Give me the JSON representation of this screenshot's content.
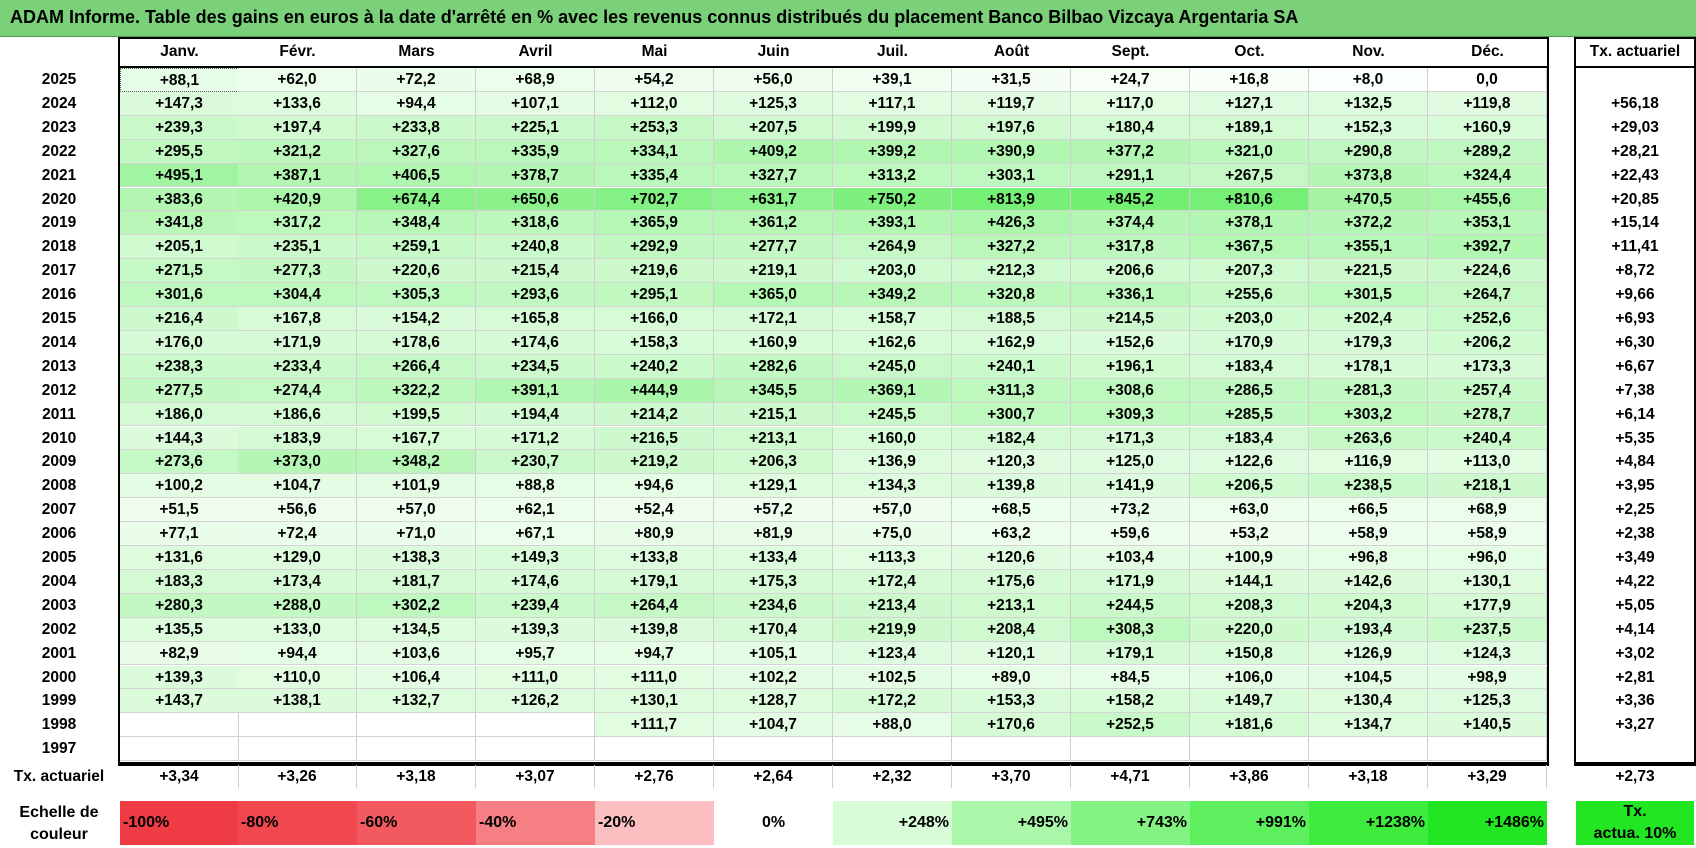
{
  "title": "ADAM Informe. Table des gains en euros à la date d'arrêté en % avec les revenus connus distribués du placement Banco Bilbao Vizcaya Argentaria SA",
  "months": [
    "Janv.",
    "Févr.",
    "Mars",
    "Avril",
    "Mai",
    "Juin",
    "Juil.",
    "Août",
    "Sept.",
    "Oct.",
    "Nov.",
    "Déc."
  ],
  "rate_header": "Tx. actuariel",
  "rows": [
    {
      "year": "2025",
      "vals": [
        "+88,1",
        "+62,0",
        "+72,2",
        "+68,9",
        "+54,2",
        "+56,0",
        "+39,1",
        "+31,5",
        "+24,7",
        "+16,8",
        "+8,0",
        "0,0"
      ],
      "rate": ""
    },
    {
      "year": "2024",
      "vals": [
        "+147,3",
        "+133,6",
        "+94,4",
        "+107,1",
        "+112,0",
        "+125,3",
        "+117,1",
        "+119,7",
        "+117,0",
        "+127,1",
        "+132,5",
        "+119,8"
      ],
      "rate": "+56,18"
    },
    {
      "year": "2023",
      "vals": [
        "+239,3",
        "+197,4",
        "+233,8",
        "+225,1",
        "+253,3",
        "+207,5",
        "+199,9",
        "+197,6",
        "+180,4",
        "+189,1",
        "+152,3",
        "+160,9"
      ],
      "rate": "+29,03"
    },
    {
      "year": "2022",
      "vals": [
        "+295,5",
        "+321,2",
        "+327,6",
        "+335,9",
        "+334,1",
        "+409,2",
        "+399,2",
        "+390,9",
        "+377,2",
        "+321,0",
        "+290,8",
        "+289,2"
      ],
      "rate": "+28,21"
    },
    {
      "year": "2021",
      "vals": [
        "+495,1",
        "+387,1",
        "+406,5",
        "+378,7",
        "+335,4",
        "+327,7",
        "+313,2",
        "+303,1",
        "+291,1",
        "+267,5",
        "+373,8",
        "+324,4"
      ],
      "rate": "+22,43"
    },
    {
      "year": "2020",
      "vals": [
        "+383,6",
        "+420,9",
        "+674,4",
        "+650,6",
        "+702,7",
        "+631,7",
        "+750,2",
        "+813,9",
        "+845,2",
        "+810,6",
        "+470,5",
        "+455,6"
      ],
      "rate": "+20,85"
    },
    {
      "year": "2019",
      "vals": [
        "+341,8",
        "+317,2",
        "+348,4",
        "+318,6",
        "+365,9",
        "+361,2",
        "+393,1",
        "+426,3",
        "+374,4",
        "+378,1",
        "+372,2",
        "+353,1"
      ],
      "rate": "+15,14"
    },
    {
      "year": "2018",
      "vals": [
        "+205,1",
        "+235,1",
        "+259,1",
        "+240,8",
        "+292,9",
        "+277,7",
        "+264,9",
        "+327,2",
        "+317,8",
        "+367,5",
        "+355,1",
        "+392,7"
      ],
      "rate": "+11,41"
    },
    {
      "year": "2017",
      "vals": [
        "+271,5",
        "+277,3",
        "+220,6",
        "+215,4",
        "+219,6",
        "+219,1",
        "+203,0",
        "+212,3",
        "+206,6",
        "+207,3",
        "+221,5",
        "+224,6"
      ],
      "rate": "+8,72"
    },
    {
      "year": "2016",
      "vals": [
        "+301,6",
        "+304,4",
        "+305,3",
        "+293,6",
        "+295,1",
        "+365,0",
        "+349,2",
        "+320,8",
        "+336,1",
        "+255,6",
        "+301,5",
        "+264,7"
      ],
      "rate": "+9,66"
    },
    {
      "year": "2015",
      "vals": [
        "+216,4",
        "+167,8",
        "+154,2",
        "+165,8",
        "+166,0",
        "+172,1",
        "+158,7",
        "+188,5",
        "+214,5",
        "+203,0",
        "+202,4",
        "+252,6"
      ],
      "rate": "+6,93"
    },
    {
      "year": "2014",
      "vals": [
        "+176,0",
        "+171,9",
        "+178,6",
        "+174,6",
        "+158,3",
        "+160,9",
        "+162,6",
        "+162,9",
        "+152,6",
        "+170,9",
        "+179,3",
        "+206,2"
      ],
      "rate": "+6,30"
    },
    {
      "year": "2013",
      "vals": [
        "+238,3",
        "+233,4",
        "+266,4",
        "+234,5",
        "+240,2",
        "+282,6",
        "+245,0",
        "+240,1",
        "+196,1",
        "+183,4",
        "+178,1",
        "+173,3"
      ],
      "rate": "+6,67"
    },
    {
      "year": "2012",
      "vals": [
        "+277,5",
        "+274,4",
        "+322,2",
        "+391,1",
        "+444,9",
        "+345,5",
        "+369,1",
        "+311,3",
        "+308,6",
        "+286,5",
        "+281,3",
        "+257,4"
      ],
      "rate": "+7,38"
    },
    {
      "year": "2011",
      "vals": [
        "+186,0",
        "+186,6",
        "+199,5",
        "+194,4",
        "+214,2",
        "+215,1",
        "+245,5",
        "+300,7",
        "+309,3",
        "+285,5",
        "+303,2",
        "+278,7"
      ],
      "rate": "+6,14"
    },
    {
      "year": "2010",
      "vals": [
        "+144,3",
        "+183,9",
        "+167,7",
        "+171,2",
        "+216,5",
        "+213,1",
        "+160,0",
        "+182,4",
        "+171,3",
        "+183,4",
        "+263,6",
        "+240,4"
      ],
      "rate": "+5,35"
    },
    {
      "year": "2009",
      "vals": [
        "+273,6",
        "+373,0",
        "+348,2",
        "+230,7",
        "+219,2",
        "+206,3",
        "+136,9",
        "+120,3",
        "+125,0",
        "+122,6",
        "+116,9",
        "+113,0"
      ],
      "rate": "+4,84"
    },
    {
      "year": "2008",
      "vals": [
        "+100,2",
        "+104,7",
        "+101,9",
        "+88,8",
        "+94,6",
        "+129,1",
        "+134,3",
        "+139,8",
        "+141,9",
        "+206,5",
        "+238,5",
        "+218,1"
      ],
      "rate": "+3,95"
    },
    {
      "year": "2007",
      "vals": [
        "+51,5",
        "+56,6",
        "+57,0",
        "+62,1",
        "+52,4",
        "+57,2",
        "+57,0",
        "+68,5",
        "+73,2",
        "+63,0",
        "+66,5",
        "+68,9"
      ],
      "rate": "+2,25"
    },
    {
      "year": "2006",
      "vals": [
        "+77,1",
        "+72,4",
        "+71,0",
        "+67,1",
        "+80,9",
        "+81,9",
        "+75,0",
        "+63,2",
        "+59,6",
        "+53,2",
        "+58,9",
        "+58,9"
      ],
      "rate": "+2,38"
    },
    {
      "year": "2005",
      "vals": [
        "+131,6",
        "+129,0",
        "+138,3",
        "+149,3",
        "+133,8",
        "+133,4",
        "+113,3",
        "+120,6",
        "+103,4",
        "+100,9",
        "+96,8",
        "+96,0"
      ],
      "rate": "+3,49"
    },
    {
      "year": "2004",
      "vals": [
        "+183,3",
        "+173,4",
        "+181,7",
        "+174,6",
        "+179,1",
        "+175,3",
        "+172,4",
        "+175,6",
        "+171,9",
        "+144,1",
        "+142,6",
        "+130,1"
      ],
      "rate": "+4,22"
    },
    {
      "year": "2003",
      "vals": [
        "+280,3",
        "+288,0",
        "+302,2",
        "+239,4",
        "+264,4",
        "+234,6",
        "+213,4",
        "+213,1",
        "+244,5",
        "+208,3",
        "+204,3",
        "+177,9"
      ],
      "rate": "+5,05"
    },
    {
      "year": "2002",
      "vals": [
        "+135,5",
        "+133,0",
        "+134,5",
        "+139,3",
        "+139,8",
        "+170,4",
        "+219,9",
        "+208,4",
        "+308,3",
        "+220,0",
        "+193,4",
        "+237,5"
      ],
      "rate": "+4,14"
    },
    {
      "year": "2001",
      "vals": [
        "+82,9",
        "+94,4",
        "+103,6",
        "+95,7",
        "+94,7",
        "+105,1",
        "+123,4",
        "+120,1",
        "+179,1",
        "+150,8",
        "+126,9",
        "+124,3"
      ],
      "rate": "+3,02"
    },
    {
      "year": "2000",
      "vals": [
        "+139,3",
        "+110,0",
        "+106,4",
        "+111,0",
        "+111,0",
        "+102,2",
        "+102,5",
        "+89,0",
        "+84,5",
        "+106,0",
        "+104,5",
        "+98,9"
      ],
      "rate": "+2,81"
    },
    {
      "year": "1999",
      "vals": [
        "+143,7",
        "+138,1",
        "+132,7",
        "+126,2",
        "+130,1",
        "+128,7",
        "+172,2",
        "+153,3",
        "+158,2",
        "+149,7",
        "+130,4",
        "+125,3"
      ],
      "rate": "+3,36"
    },
    {
      "year": "1998",
      "vals": [
        "",
        "",
        "",
        "",
        "+111,7",
        "+104,7",
        "+88,0",
        "+170,6",
        "+252,5",
        "+181,6",
        "+134,7",
        "+140,5"
      ],
      "rate": "+3,27"
    },
    {
      "year": "1997",
      "vals": [
        "",
        "",
        "",
        "",
        "",
        "",
        "",
        "",
        "",
        "",
        "",
        ""
      ],
      "rate": ""
    }
  ],
  "footer": {
    "label": "Tx. actuariel",
    "vals": [
      "+3,34",
      "+3,26",
      "+3,18",
      "+3,07",
      "+2,76",
      "+2,64",
      "+2,32",
      "+3,70",
      "+4,71",
      "+3,86",
      "+3,18",
      "+3,29"
    ],
    "rate": "+2,73"
  },
  "legend": {
    "label_line1": "Echelle de",
    "label_line2": "couleur",
    "cells": [
      {
        "text": "-100%",
        "color": "#ef3b43"
      },
      {
        "text": "-80%",
        "color": "#f1484f"
      },
      {
        "text": "-60%",
        "color": "#f35a60"
      },
      {
        "text": "-40%",
        "color": "#f67f83"
      },
      {
        "text": "-20%",
        "color": "#fbbfc1"
      },
      {
        "text": "0%",
        "color": "#ffffff"
      },
      {
        "text": "+248%",
        "color": "#d8fbd8"
      },
      {
        "text": "+495%",
        "color": "#aaf7aa"
      },
      {
        "text": "+743%",
        "color": "#83f383"
      },
      {
        "text": "+991%",
        "color": "#5eef5e"
      },
      {
        "text": "+1238%",
        "color": "#3eec3e"
      },
      {
        "text": "+1486%",
        "color": "#22e622"
      }
    ],
    "rate_line1": "Tx.",
    "rate_line2": "actua. 10%",
    "rate_color": "#22e622"
  },
  "colors": {
    "title_bg": "#7ad17a",
    "max_green": "#22e622"
  }
}
